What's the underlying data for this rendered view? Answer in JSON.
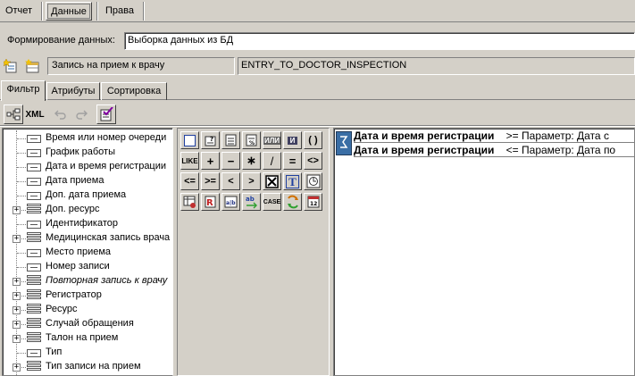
{
  "top_tabs": [
    "Отчет",
    "Данные",
    "Права"
  ],
  "formation": {
    "label": "Формирование данных:",
    "value": "Выборка данных из БД"
  },
  "entity": {
    "name": "Запись на прием к врачу",
    "code": "ENTRY_TO_DOCTOR_INSPECTION"
  },
  "sub_tabs": [
    "Фильтр",
    "Атрибуты",
    "Сортировка"
  ],
  "toolbar": {
    "xml_label": "XML"
  },
  "tree_items": [
    {
      "label": "Время или номер очереди",
      "type": "field",
      "expandable": false,
      "italic": false
    },
    {
      "label": "График работы",
      "type": "field",
      "expandable": false,
      "italic": false
    },
    {
      "label": "Дата и время регистрации",
      "type": "field",
      "expandable": false,
      "italic": false
    },
    {
      "label": "Дата приема",
      "type": "field",
      "expandable": false,
      "italic": false
    },
    {
      "label": "Доп. дата приема",
      "type": "field",
      "expandable": false,
      "italic": false
    },
    {
      "label": "Доп. ресурс",
      "type": "table",
      "expandable": true,
      "italic": false
    },
    {
      "label": "Идентификатор",
      "type": "field",
      "expandable": false,
      "italic": false
    },
    {
      "label": "Медицинская запись врача",
      "type": "table",
      "expandable": true,
      "italic": false
    },
    {
      "label": "Место приема",
      "type": "field",
      "expandable": false,
      "italic": false
    },
    {
      "label": "Номер записи",
      "type": "field",
      "expandable": false,
      "italic": false
    },
    {
      "label": "Повторная запись к врачу",
      "type": "table",
      "expandable": true,
      "italic": true
    },
    {
      "label": "Регистратор",
      "type": "table",
      "expandable": true,
      "italic": false
    },
    {
      "label": "Ресурс",
      "type": "table",
      "expandable": true,
      "italic": false
    },
    {
      "label": "Случай обращения",
      "type": "table",
      "expandable": true,
      "italic": false
    },
    {
      "label": "Талон на прием",
      "type": "table",
      "expandable": true,
      "italic": false
    },
    {
      "label": "Тип",
      "type": "field",
      "expandable": false,
      "italic": false
    },
    {
      "label": "Тип записи на прием",
      "type": "table",
      "expandable": true,
      "italic": false
    }
  ],
  "palette": {
    "or": "ИЛИ",
    "and": "И",
    "parens": "( )",
    "like": "LIKE",
    "plus": "+",
    "minus": "−",
    "times": "∗",
    "divide": "/",
    "eq": "=",
    "neq": "<>",
    "le": "<=",
    "ge": ">=",
    "lt": "<",
    "gt": ">",
    "text": "T",
    "case": "CASE"
  },
  "conditions": [
    {
      "field": "Дата и время регистрации",
      "op": ">= Параметр: Дата с"
    },
    {
      "field": "Дата и время регистрации",
      "op": "<= Параметр: Дата по"
    }
  ]
}
